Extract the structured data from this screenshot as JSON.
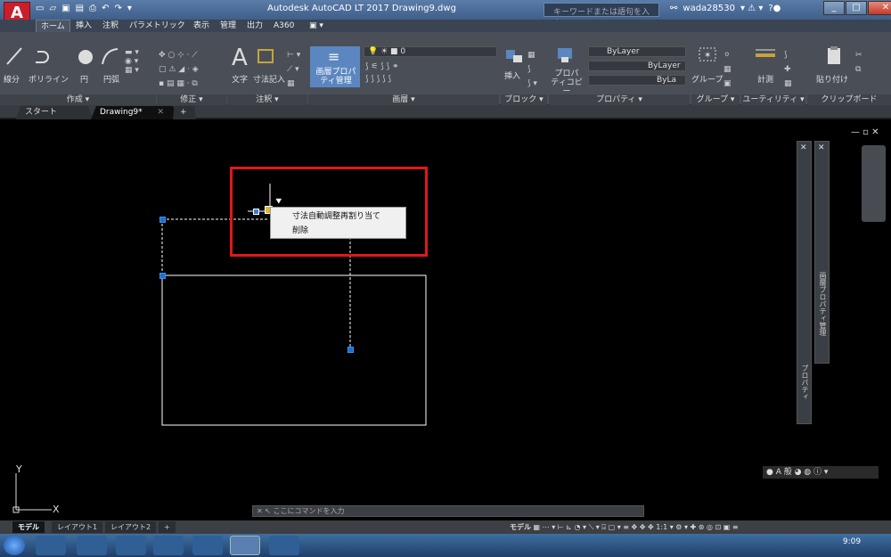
{
  "window": {
    "title": "Autodesk AutoCAD LT 2017    Drawing9.dwg",
    "app_badge": "LT",
    "search_placeholder": "キーワードまたは語句を入力",
    "user": "wada28530"
  },
  "ribbon_tabs": [
    "ホーム",
    "挿入",
    "注釈",
    "パラメトリック",
    "表示",
    "管理",
    "出力",
    "A360"
  ],
  "ribbon_groups": {
    "draw": {
      "label": "作成 ▾",
      "items": [
        "線分",
        "ポリライン",
        "円",
        "円弧"
      ]
    },
    "modify": {
      "label": "修正 ▾"
    },
    "annotation": {
      "label": "注釈 ▾",
      "items": [
        "文字",
        "寸法記入"
      ]
    },
    "layers": {
      "label": "画層 ▾",
      "layer_props": "画層プロパティ管理",
      "current_layer": "0"
    },
    "block": {
      "label": "ブロック ▾",
      "insert": "挿入"
    },
    "properties": {
      "label": "プロパティ ▾",
      "copy": "プロパティコピー",
      "color": "ByLayer",
      "linetype": "ByLayer",
      "lineweight": "ByLa"
    },
    "groups": {
      "label": "グループ ▾",
      "group": "グループ"
    },
    "utilities": {
      "label": "ユーティリティ ▾",
      "measure": "計測"
    },
    "clipboard": {
      "label": "クリップボード",
      "paste": "貼り付け"
    }
  },
  "doc_tabs": [
    "スタート",
    "Drawing9*"
  ],
  "context_menu": [
    "寸法自動調整再割り当て",
    "削除"
  ],
  "palettes": {
    "properties": "プロパティ",
    "layers": "画層プロパティ管理"
  },
  "command_placeholder": "ここにコマンドを入力",
  "layout_tabs": [
    "モデル",
    "レイアウト1",
    "レイアウト2"
  ],
  "status": {
    "model": "モデル",
    "scale": "1:1"
  },
  "clock": "9:09",
  "colors": {
    "accent": "#1e6fd0",
    "highlight_box": "#e01818",
    "title_bg": "#4a6b96"
  }
}
